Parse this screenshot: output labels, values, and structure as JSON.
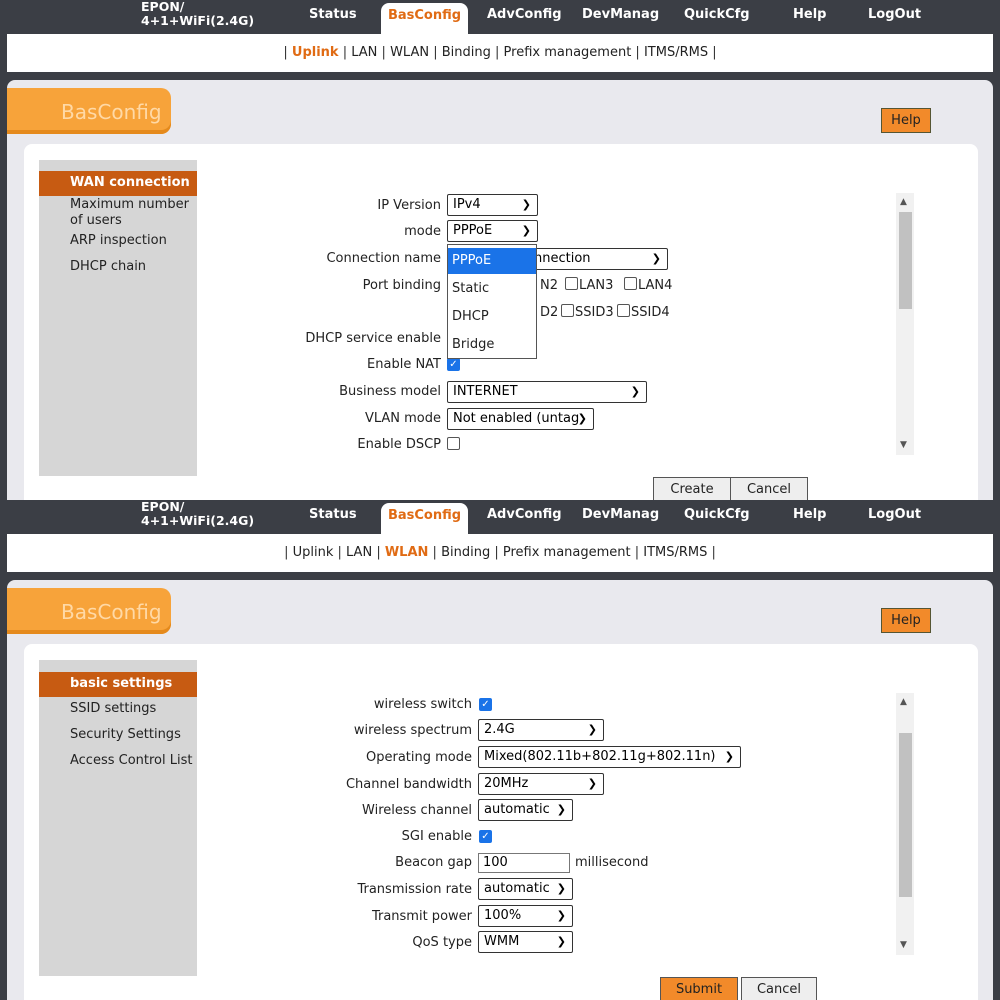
{
  "header": {
    "logo_line1": "EPON/",
    "logo_line2": "4+1+WiFi(2.4G)",
    "nav": [
      "Status",
      "BasConfig",
      "AdvConfig",
      "DevManag",
      "QuickCfg",
      "Help",
      "LogOut"
    ],
    "active_nav": "BasConfig"
  },
  "submenu": {
    "items": [
      "Uplink",
      "LAN",
      "WLAN",
      "Binding",
      "Prefix management",
      "ITMS/RMS"
    ]
  },
  "section_badge": "BasConfig",
  "help_button": "Help",
  "panel1": {
    "active_sub": "Uplink",
    "sidebar": [
      "WAN connection",
      "Maximum number of users",
      "ARP inspection",
      "DHCP chain"
    ],
    "form": {
      "ip_version_label": "IP Version",
      "ip_version_value": "IPv4",
      "mode_label": "mode",
      "mode_value": "PPPoE",
      "connection_name_label": "Connection name",
      "connection_name_value": "nnection",
      "port_binding_label": "Port binding",
      "lan_ports": [
        "N2",
        "LAN3",
        "LAN4"
      ],
      "ssid_ports": [
        "D2",
        "SSID3",
        "SSID4"
      ],
      "dhcp_service_label": "DHCP service enable",
      "enable_nat_label": "Enable NAT",
      "business_model_label": "Business model",
      "business_model_value": "INTERNET",
      "vlan_mode_label": "VLAN mode",
      "vlan_mode_value": "Not enabled (untag",
      "enable_dscp_label": "Enable DSCP"
    },
    "mode_dropdown_options": [
      "PPPoE",
      "Static",
      "DHCP",
      "Bridge"
    ],
    "create_button": "Create",
    "cancel_button": "Cancel"
  },
  "panel2": {
    "active_sub": "WLAN",
    "sidebar": [
      "basic settings",
      "SSID settings",
      "Security Settings",
      "Access Control List"
    ],
    "form": {
      "wireless_switch_label": "wireless switch",
      "wireless_spectrum_label": "wireless spectrum",
      "wireless_spectrum_value": "2.4G",
      "operating_mode_label": "Operating mode",
      "operating_mode_value": "Mixed(802.11b+802.11g+802.11n)",
      "channel_bandwidth_label": "Channel bandwidth",
      "channel_bandwidth_value": "20MHz",
      "wireless_channel_label": "Wireless channel",
      "wireless_channel_value": "automatic",
      "sgi_enable_label": "SGI enable",
      "beacon_gap_label": "Beacon gap",
      "beacon_gap_value": "100",
      "beacon_gap_unit": "millisecond",
      "transmission_rate_label": "Transmission rate",
      "transmission_rate_value": "automatic",
      "transmit_power_label": "Transmit power",
      "transmit_power_value": "100%",
      "qos_type_label": "QoS type",
      "qos_type_value": "WMM"
    },
    "submit_button": "Submit",
    "cancel_button": "Cancel"
  }
}
